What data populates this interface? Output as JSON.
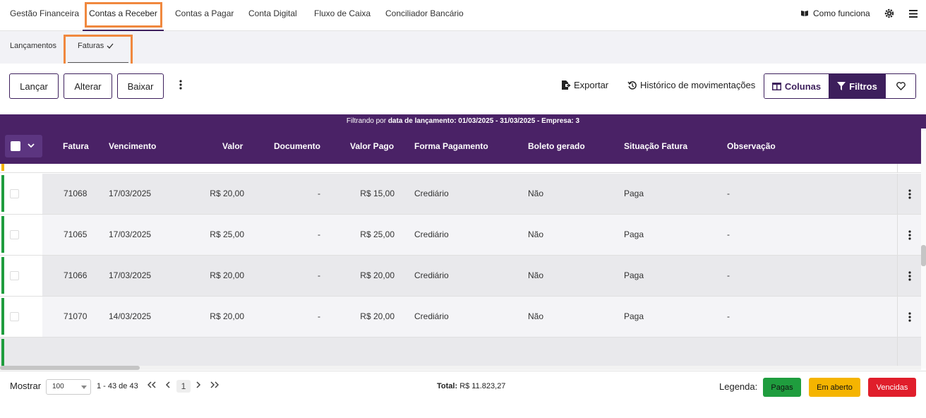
{
  "top_tabs": [
    "Gestão Financeira",
    "Contas a Receber",
    "Contas a Pagar",
    "Conta Digital",
    "Fluxo de Caixa",
    "Conciliador Bancário"
  ],
  "top_right": {
    "help_label": "Como funciona",
    "help_icon": "book-icon",
    "settings_icon": "gear-icon",
    "menu_icon": "hamburger-icon"
  },
  "sub_tabs": {
    "lancamentos": "Lançamentos",
    "faturas": "Faturas"
  },
  "toolbar": {
    "lancar": "Lançar",
    "alterar": "Alterar",
    "baixar": "Baixar",
    "exportar": "Exportar",
    "historico": "Histórico de movimentações",
    "colunas": "Colunas",
    "filtros": "Filtros"
  },
  "filter_bar": {
    "prefix": "Filtrando por",
    "detail": "data de lançamento: 01/03/2025 - 31/03/2025 - Empresa: 3"
  },
  "table": {
    "headers": [
      "Fatura",
      "Vencimento",
      "Valor",
      "Documento",
      "Valor Pago",
      "Forma Pagamento",
      "Boleto gerado",
      "Situação Fatura",
      "Observação"
    ],
    "rows": [
      {
        "fatura": "71068",
        "vencimento": "17/03/2025",
        "valor": "R$ 20,00",
        "documento": "-",
        "valor_pago": "R$ 15,00",
        "forma": "Crediário",
        "boleto": "Não",
        "situacao": "Paga",
        "obs": "-"
      },
      {
        "fatura": "71065",
        "vencimento": "17/03/2025",
        "valor": "R$ 25,00",
        "documento": "-",
        "valor_pago": "R$ 25,00",
        "forma": "Crediário",
        "boleto": "Não",
        "situacao": "Paga",
        "obs": "-"
      },
      {
        "fatura": "71066",
        "vencimento": "17/03/2025",
        "valor": "R$ 20,00",
        "documento": "-",
        "valor_pago": "R$ 20,00",
        "forma": "Crediário",
        "boleto": "Não",
        "situacao": "Paga",
        "obs": "-"
      },
      {
        "fatura": "71070",
        "vencimento": "14/03/2025",
        "valor": "R$ 20,00",
        "documento": "-",
        "valor_pago": "R$ 20,00",
        "forma": "Crediário",
        "boleto": "Não",
        "situacao": "Paga",
        "obs": "-"
      }
    ]
  },
  "footer": {
    "mostrar": "Mostrar",
    "page_size": "100",
    "range": "1 - 43 de 43",
    "current_page": "1",
    "total_label": "Total:",
    "total_value": "R$ 11.823,27",
    "legenda": "Legenda:",
    "legend_items": [
      "Pagas",
      "Em aberto",
      "Vencidas"
    ]
  },
  "colors": {
    "brand_purple": "#4a2266",
    "highlight_orange": "#f0883e",
    "paid_green": "#1f9d3e",
    "open_yellow": "#f5b400",
    "overdue_red": "#e01e2b"
  }
}
